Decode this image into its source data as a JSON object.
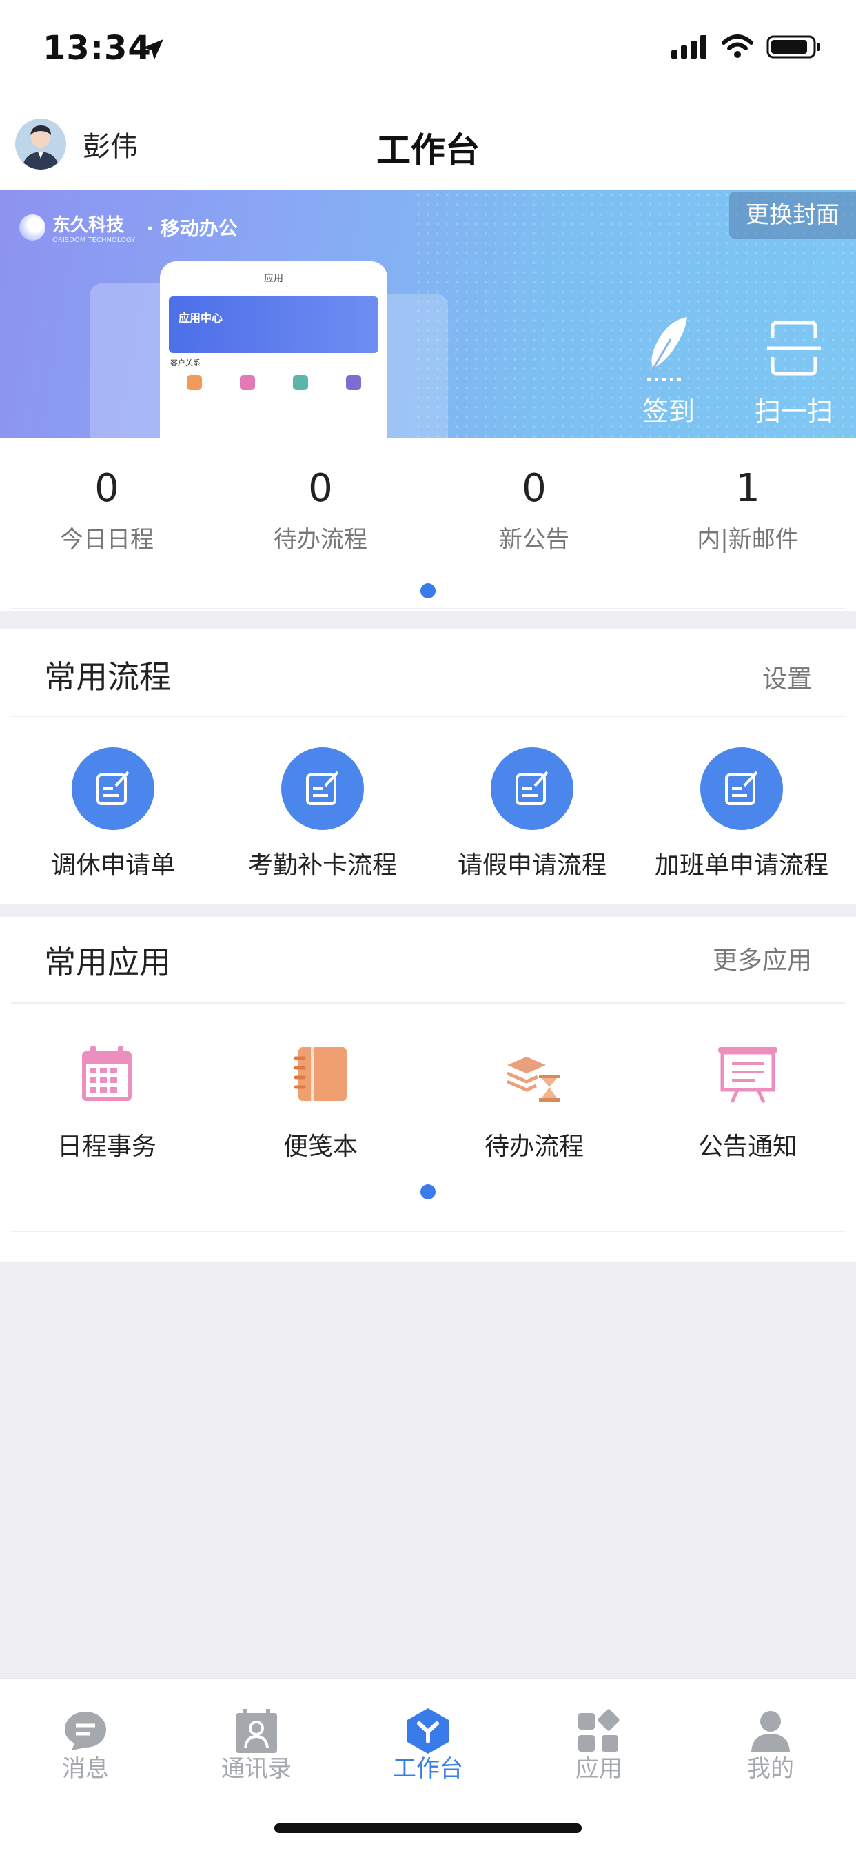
{
  "status_bar": {
    "time": "13:34"
  },
  "header": {
    "user_name": "彭伟",
    "title": "工作台"
  },
  "banner": {
    "brand_name": "东久科技",
    "brand_sub": "ORISDOM TECHNOLOGY",
    "slogan": "· 移动办公",
    "change_cover": "更换封面",
    "phone_title": "应用",
    "phone_hero": "应用中心",
    "phone_section": "客户关系",
    "actions": [
      {
        "label": "签到",
        "icon": "feather-icon"
      },
      {
        "label": "扫一扫",
        "icon": "scan-icon"
      }
    ]
  },
  "stats": [
    {
      "value": "0",
      "label": "今日日程"
    },
    {
      "value": "0",
      "label": "待办流程"
    },
    {
      "value": "0",
      "label": "新公告"
    },
    {
      "value": "1",
      "label": "内|新邮件"
    }
  ],
  "common_processes": {
    "title": "常用流程",
    "link": "设置",
    "items": [
      {
        "label": "调休申请单",
        "icon": "form-edit-icon"
      },
      {
        "label": "考勤补卡流程",
        "icon": "form-edit-icon"
      },
      {
        "label": "请假申请流程",
        "icon": "form-edit-icon"
      },
      {
        "label": "加班单申请流程",
        "icon": "form-edit-icon"
      }
    ]
  },
  "common_apps": {
    "title": "常用应用",
    "link": "更多应用",
    "items": [
      {
        "label": "日程事务",
        "icon": "calendar-icon",
        "color": "#ec8fbf"
      },
      {
        "label": "便笺本",
        "icon": "notebook-icon",
        "color": "#f0a070"
      },
      {
        "label": "待办流程",
        "icon": "hourglass-icon",
        "color": "#eaa07a"
      },
      {
        "label": "公告通知",
        "icon": "board-icon",
        "color": "#ec8fbf"
      }
    ]
  },
  "tabbar": {
    "tabs": [
      {
        "label": "消息",
        "icon": "message-icon",
        "active": false
      },
      {
        "label": "通讯录",
        "icon": "contacts-icon",
        "active": false
      },
      {
        "label": "工作台",
        "icon": "workbench-icon",
        "active": true
      },
      {
        "label": "应用",
        "icon": "apps-icon",
        "active": false
      },
      {
        "label": "我的",
        "icon": "profile-icon",
        "active": false
      }
    ]
  },
  "colors": {
    "accent": "#3a7bea",
    "process_circle": "#4a86ec",
    "inactive_tab": "#a5a8ad"
  }
}
